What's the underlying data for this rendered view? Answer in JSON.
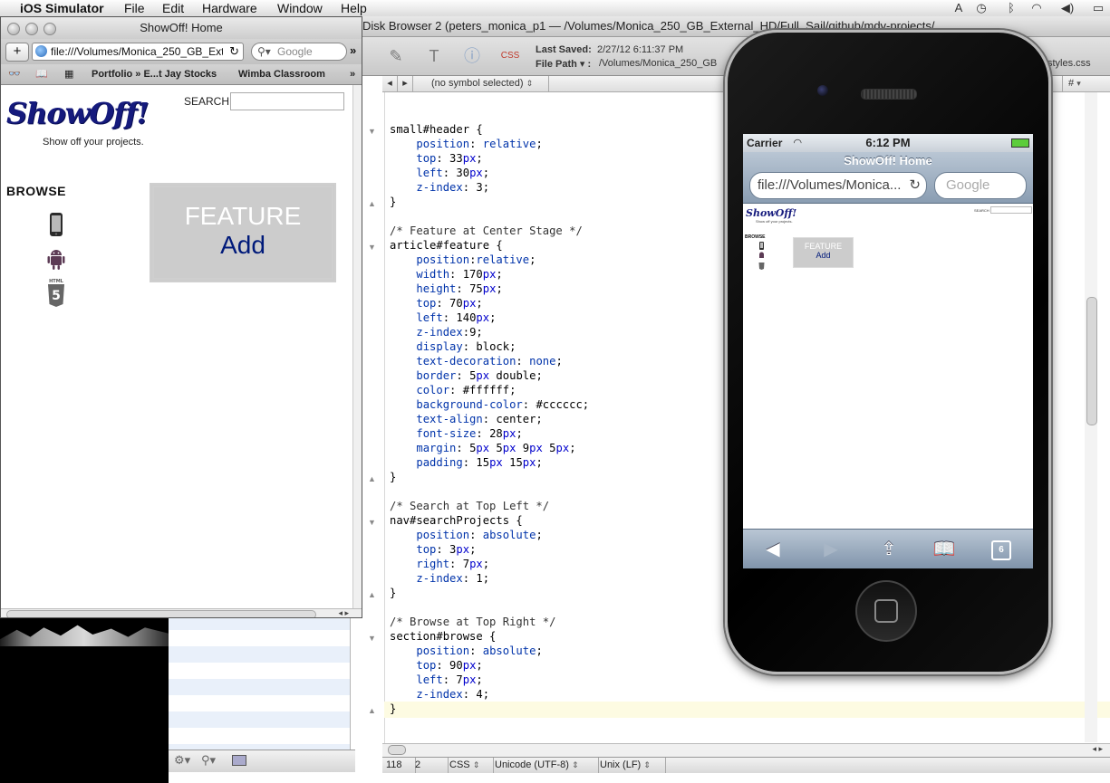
{
  "menubar": {
    "app_name": "iOS Simulator",
    "items": [
      "File",
      "Edit",
      "Hardware",
      "Window",
      "Help"
    ]
  },
  "editor": {
    "window_title": "Disk Browser 2 (peters_monica_p1 — /Volumes/Monica_250_GB_External_HD/Full_Sail/github/mdv-projects/...",
    "last_saved_label": "Last Saved:",
    "last_saved_value": "2/27/12 6:11:37 PM",
    "file_path_label": "File Path ▾ :",
    "file_path_value": "/Volumes/Monica_250_GB",
    "symbol_selector": "(no symbol selected)",
    "tab_right": "styles.css",
    "hash_menu": "#",
    "code_lines": [
      "small#header {",
      "    position: relative;",
      "    top: 33px;",
      "    left: 30px;",
      "    z-index: 3;",
      "}",
      "",
      "/* Feature at Center Stage */",
      "article#feature {",
      "    position:relative;",
      "    width: 170px;",
      "    height: 75px;",
      "    top: 70px;",
      "    left: 140px;",
      "    z-index:9;",
      "    display: block;",
      "    text-decoration: none;",
      "    border: 5px double;",
      "    color: #ffffff;",
      "    background-color: #cccccc;",
      "    text-align: center;",
      "    font-size: 28px;",
      "    margin: 5px 5px 9px 5px;",
      "    padding: 15px 15px;",
      "}",
      "",
      "/* Search at Top Left */",
      "nav#searchProjects {",
      "    position: absolute;",
      "    top: 3px;",
      "    right: 7px;",
      "    z-index: 1;",
      "}",
      "",
      "/* Browse at Top Right */",
      "section#browse {",
      "    position: absolute;",
      "    top: 90px;",
      "    left: 7px;",
      "    z-index: 4;",
      "}"
    ],
    "status": {
      "line": "118",
      "col": "2",
      "language": "CSS",
      "encoding": "Unicode (UTF-8)",
      "line_endings": "Unix (LF)"
    }
  },
  "safari": {
    "title": "ShowOff! Home",
    "url": "file:///Volumes/Monica_250_GB_External_HD",
    "search_placeholder": "Google",
    "bookmarks": [
      "Portfolio » E...t Jay Stocks",
      "Wimba Classroom"
    ],
    "page": {
      "logo": "ShowOff!",
      "tagline": "Show off your projects.",
      "search_label": "SEARCH",
      "browse_label": "BROWSE",
      "feature_title": "FEATURE",
      "feature_action": "Add"
    }
  },
  "iphone": {
    "carrier": "Carrier",
    "time": "6:12 PM",
    "page_title": "ShowOff! Home",
    "url": "file:///Volumes/Monica...",
    "search_placeholder": "Google",
    "tab_count": "6",
    "page": {
      "logo": "ShowOff!",
      "tagline": "Show off your projects.",
      "search_label": "SEARCH",
      "browse_label": "BROWSE",
      "feature_title": "FEATURE",
      "feature_action": "Add"
    }
  },
  "colors": {
    "logo": "#151a7d",
    "feature_bg": "#cccccc",
    "feature_text": "#ffffff",
    "feature_link": "#001a7a",
    "css_keyword": "#0033aa"
  }
}
